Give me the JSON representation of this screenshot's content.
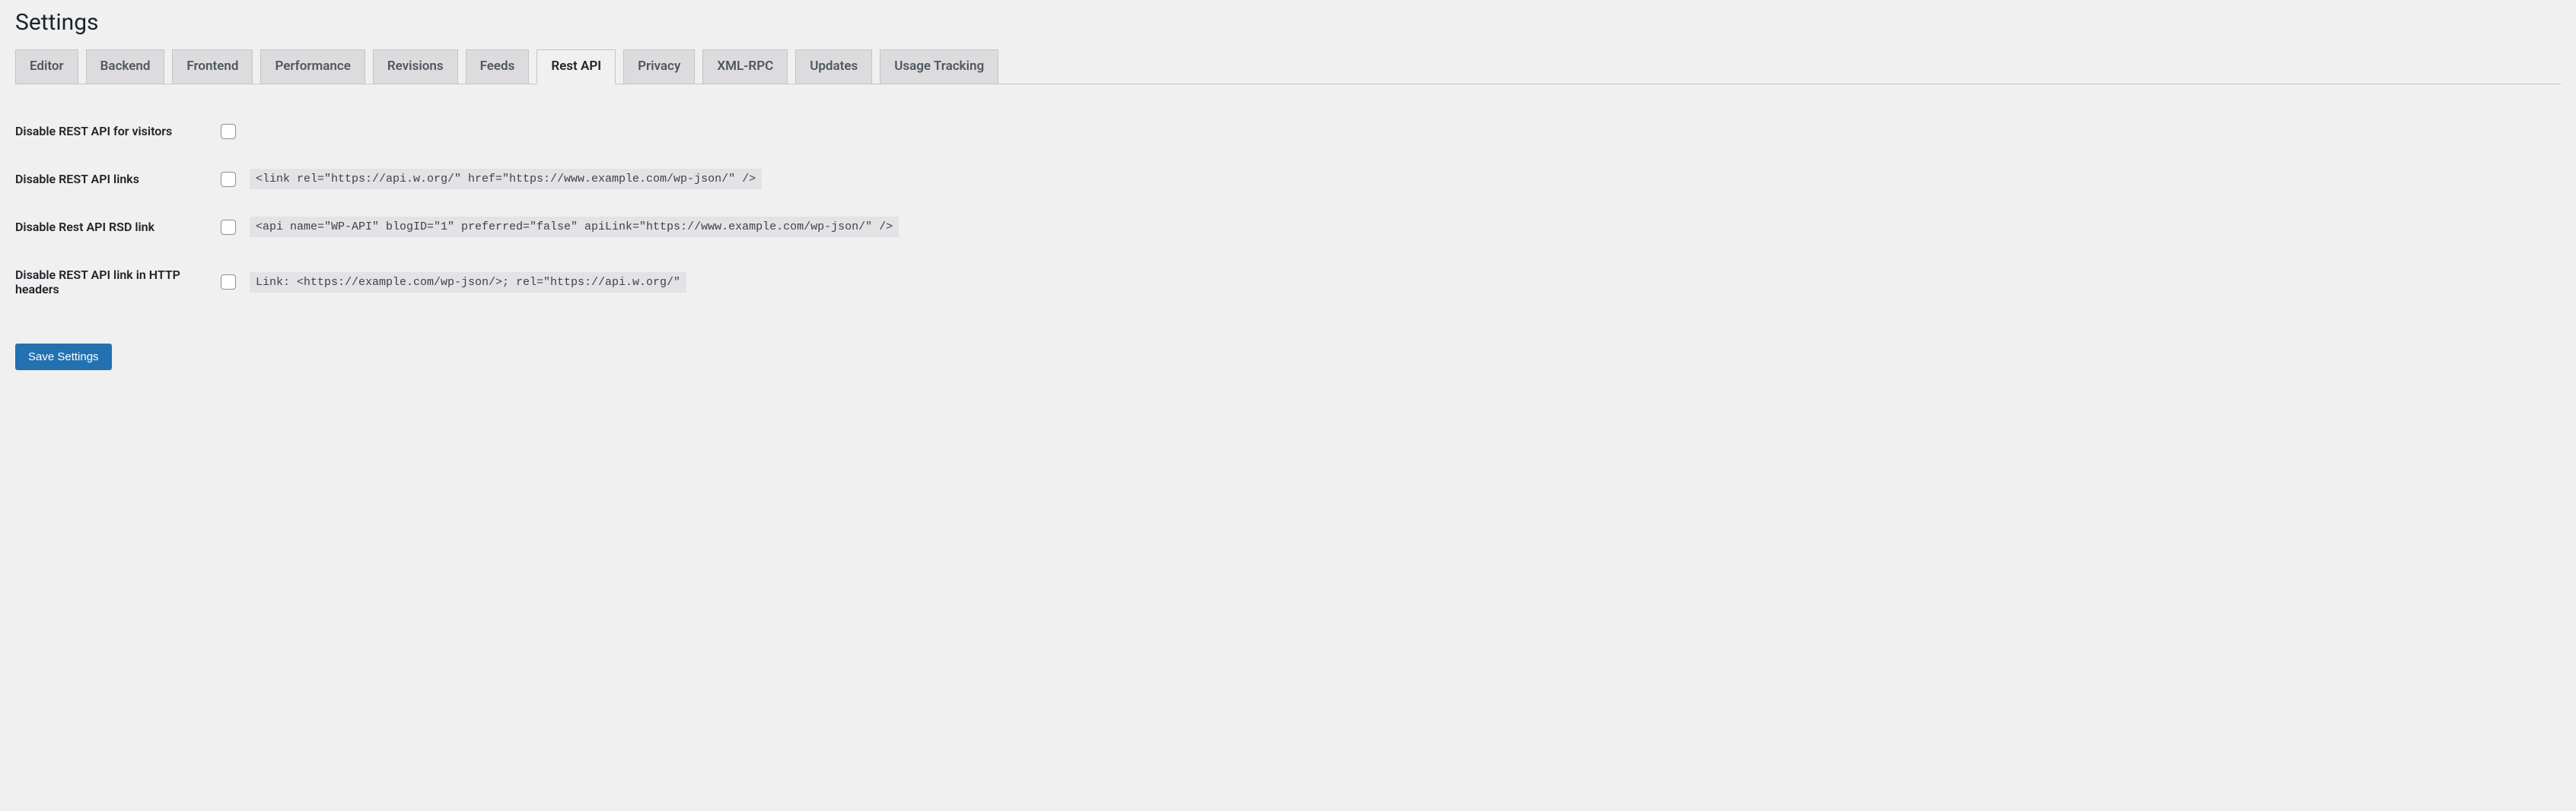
{
  "page_title": "Settings",
  "tabs": [
    {
      "label": "Editor",
      "active": false
    },
    {
      "label": "Backend",
      "active": false
    },
    {
      "label": "Frontend",
      "active": false
    },
    {
      "label": "Performance",
      "active": false
    },
    {
      "label": "Revisions",
      "active": false
    },
    {
      "label": "Feeds",
      "active": false
    },
    {
      "label": "Rest API",
      "active": true
    },
    {
      "label": "Privacy",
      "active": false
    },
    {
      "label": "XML-RPC",
      "active": false
    },
    {
      "label": "Updates",
      "active": false
    },
    {
      "label": "Usage Tracking",
      "active": false
    }
  ],
  "rows": [
    {
      "label": "Disable REST API for visitors",
      "code": ""
    },
    {
      "label": "Disable REST API links",
      "code": "<link rel=\"https://api.w.org/\" href=\"https://www.example.com/wp-json/\" />"
    },
    {
      "label": "Disable Rest API RSD link",
      "code": "<api name=\"WP-API\" blogID=\"1\" preferred=\"false\" apiLink=\"https://www.example.com/wp-json/\" />"
    },
    {
      "label": "Disable REST API link in HTTP headers",
      "code": "Link: <https://example.com/wp-json/>; rel=\"https://api.w.org/\""
    }
  ],
  "save_button": "Save Settings"
}
